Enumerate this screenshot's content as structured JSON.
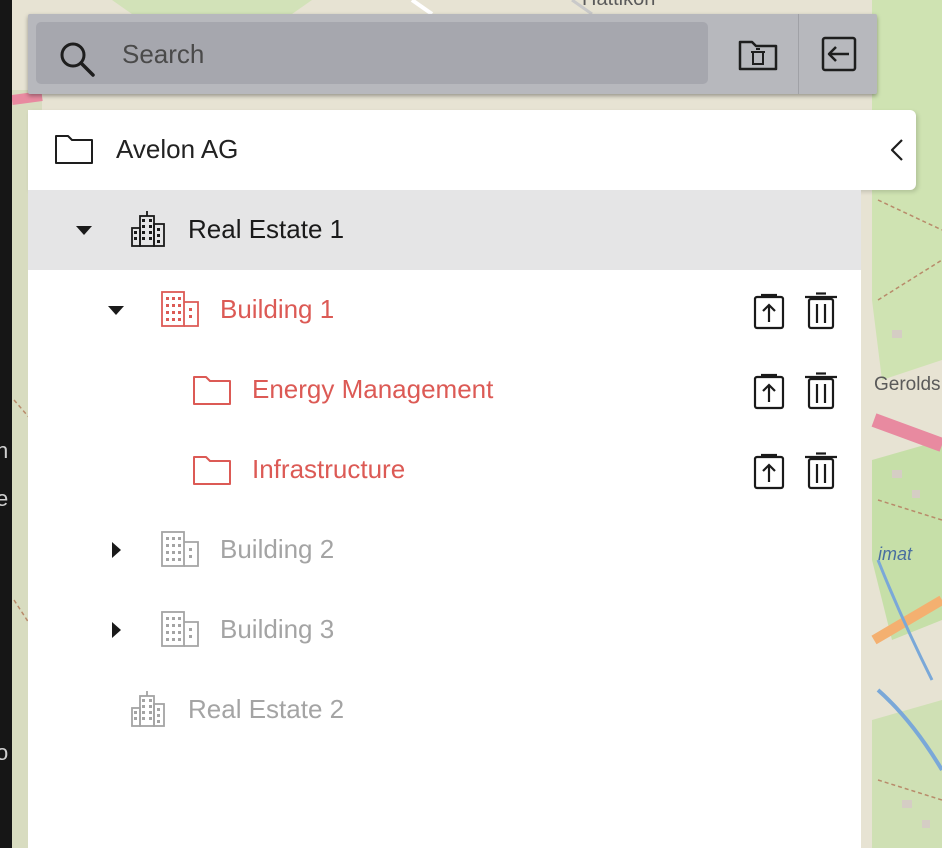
{
  "map": {
    "labels": {
      "gerold": "Gerolds",
      "imat": "imat",
      "hattikon": "Hattikon"
    },
    "strip_letters": [
      "n",
      "e",
      "o"
    ]
  },
  "toolbar": {
    "search": {
      "placeholder": "Search",
      "value": "",
      "icon": "search-icon"
    },
    "folder_delete_icon": "folder-delete-icon",
    "collapse_panel_icon": "collapse-panel-icon"
  },
  "tree": {
    "root": {
      "label": "Avelon AG",
      "icon": "folder-icon",
      "toggle_icon": "chevron-left-icon"
    },
    "nodes": [
      {
        "label": "Real Estate 1",
        "type": "real-estate",
        "expanded": true,
        "selected": true,
        "color": "#1a1a1a"
      },
      {
        "label": "Building 1",
        "type": "building",
        "expanded": true,
        "color": "#dc5a55"
      },
      {
        "label": "Energy Management",
        "type": "folder",
        "color": "#dc5a55"
      },
      {
        "label": "Infrastructure",
        "type": "folder",
        "color": "#dc5a55"
      },
      {
        "label": "Building 2",
        "type": "building",
        "expanded": false,
        "color": "#a4a4a4"
      },
      {
        "label": "Building 3",
        "type": "building",
        "expanded": false,
        "color": "#a4a4a4"
      },
      {
        "label": "Real Estate 2",
        "type": "real-estate",
        "color": "#a4a4a4"
      }
    ]
  },
  "colors": {
    "active": "#dc5a55",
    "inactive": "#a4a4a4",
    "selected_row": "#e5e5e6",
    "toolbar": "#b7b8bd"
  }
}
